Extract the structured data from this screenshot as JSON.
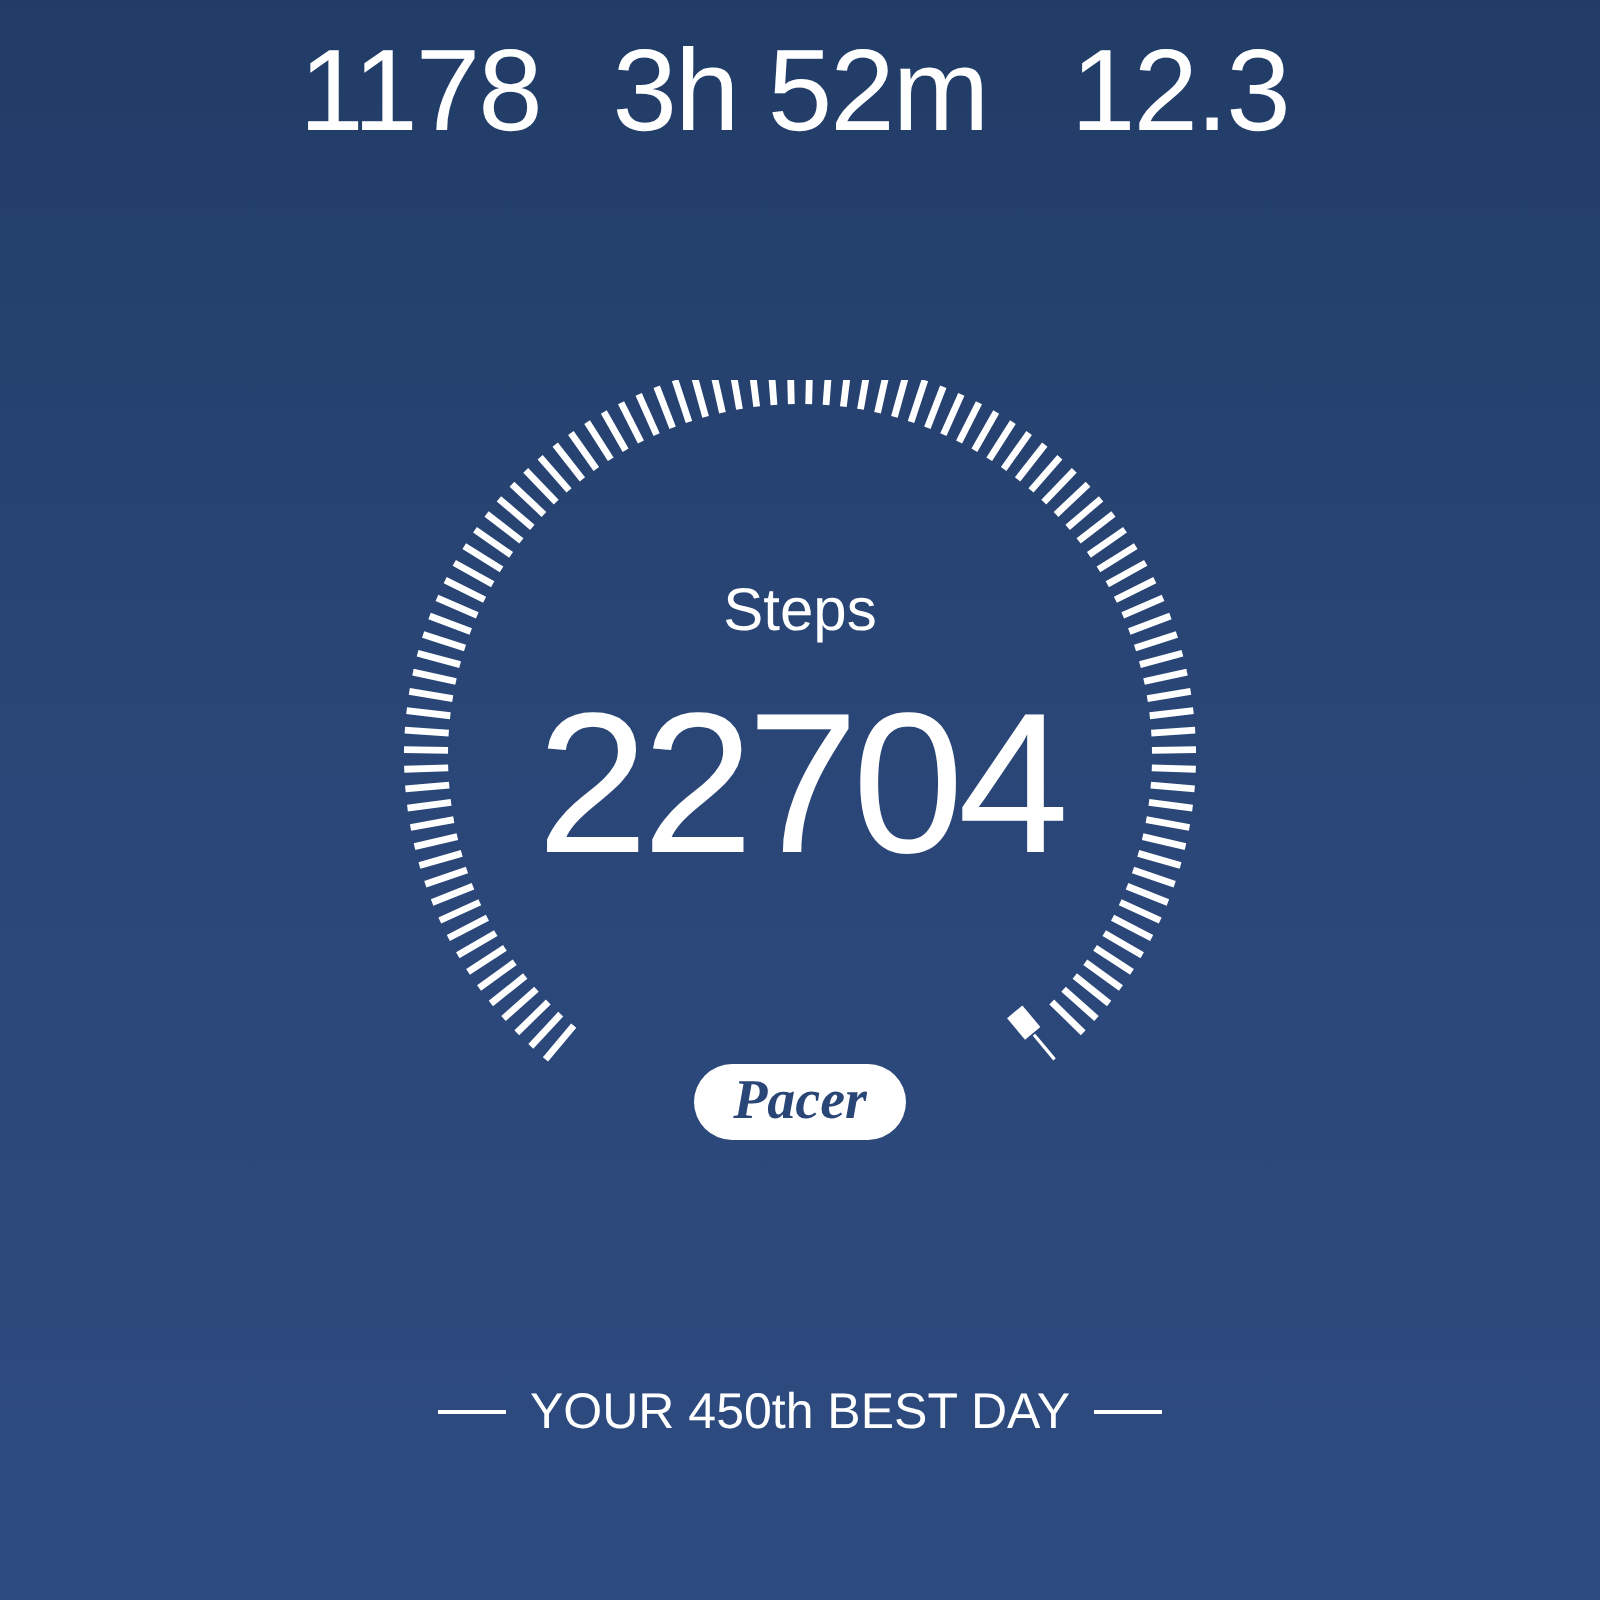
{
  "stats": [
    {
      "value": "1178"
    },
    {
      "value": "3h 52m"
    },
    {
      "value": "12.3"
    }
  ],
  "steps": {
    "label": "Steps",
    "value": "22704"
  },
  "logo": "Pacer",
  "best_day": "YOUR 450th BEST DAY"
}
